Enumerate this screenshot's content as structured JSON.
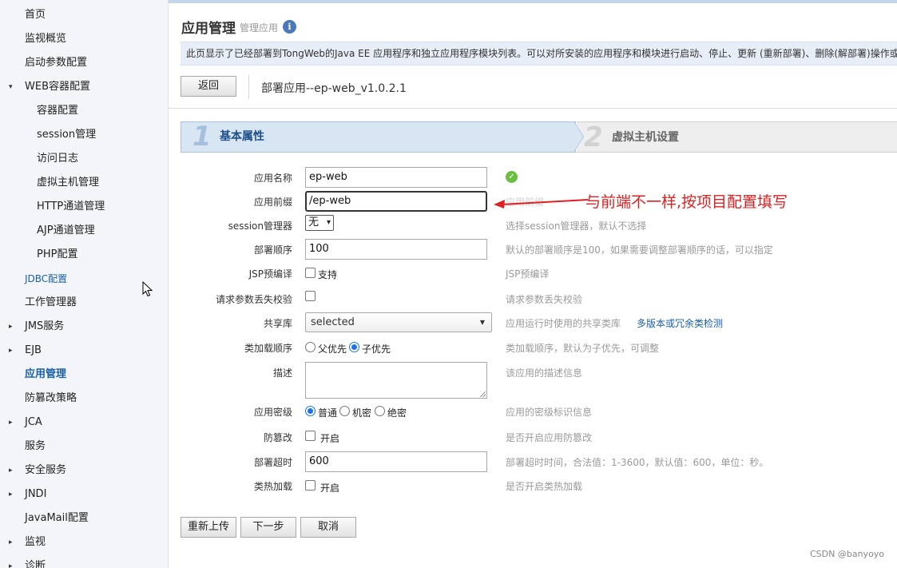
{
  "sidebar": {
    "items": [
      {
        "label": "首页"
      },
      {
        "label": "监视概览"
      },
      {
        "label": "启动参数配置"
      },
      {
        "label": "WEB容器配置",
        "caret": "▾"
      },
      {
        "label": "容器配置"
      },
      {
        "label": "session管理"
      },
      {
        "label": "访问日志"
      },
      {
        "label": "虚拟主机管理"
      },
      {
        "label": "HTTP通道管理"
      },
      {
        "label": "AJP通道管理"
      },
      {
        "label": "PHP配置"
      },
      {
        "label": "JDBC配置"
      },
      {
        "label": "工作管理器"
      },
      {
        "label": "JMS服务",
        "caret": "▸"
      },
      {
        "label": "EJB",
        "caret": "▸"
      },
      {
        "label": "应用管理"
      },
      {
        "label": "防篡改策略"
      },
      {
        "label": "JCA",
        "caret": "▸"
      },
      {
        "label": "服务"
      },
      {
        "label": "安全服务",
        "caret": "▸"
      },
      {
        "label": "JNDI",
        "caret": "▸"
      },
      {
        "label": "JavaMail配置"
      },
      {
        "label": "监视",
        "caret": "▸"
      },
      {
        "label": "诊断",
        "caret": "▸"
      }
    ]
  },
  "header": {
    "title": "应用管理",
    "subtitle": "管理应用",
    "info_glyph": "i",
    "description": "此页显示了已经部署到TongWeb的Java EE 应用程序和独立应用程序模块列表。可以对所安装的应用程序和模块进行启动、停止、更新 (重新部署)、删除(解部署)操作或者"
  },
  "toolbar": {
    "back_label": "返回",
    "deploy_title": "部署应用--ep-web_v1.0.2.1"
  },
  "steps": [
    {
      "num": "1",
      "label": "基本属性"
    },
    {
      "num": "2",
      "label": "虚拟主机设置"
    }
  ],
  "form": {
    "app_name": {
      "label": "应用名称",
      "value": "ep-web"
    },
    "app_prefix": {
      "label": "应用前缀",
      "value": "/ep-web",
      "hint": "应用前缀"
    },
    "session_mgr": {
      "label": "session管理器",
      "value": "无",
      "hint": "选择session管理器，默认不选择"
    },
    "deploy_order": {
      "label": "部署顺序",
      "value": "100",
      "hint": "默认的部署顺序是100，如果需要调整部署顺序的话，可以指定"
    },
    "jsp_precompile": {
      "label": "JSP预编译",
      "option": "支持",
      "hint": "JSP预编译"
    },
    "param_check": {
      "label": "请求参数丢失校验",
      "hint": "请求参数丢失校验"
    },
    "shared_lib": {
      "label": "共享库",
      "value": "selected",
      "hint": "应用运行时使用的共享类库",
      "link": "多版本或冗余类检测"
    },
    "class_order": {
      "label": "类加载顺序",
      "opt1": "父优先",
      "opt2": "子优先",
      "hint": "类加载顺序，默认为子优先，可调整"
    },
    "description": {
      "label": "描述",
      "hint": "该应用的描述信息"
    },
    "secret_level": {
      "label": "应用密级",
      "opt1": "普通",
      "opt2": "机密",
      "opt3": "绝密",
      "hint": "应用的密级标识信息"
    },
    "tamper": {
      "label": "防篡改",
      "option": "开启",
      "hint": "是否开启应用防篡改"
    },
    "deploy_timeout": {
      "label": "部署超时",
      "value": "600",
      "hint": "部署超时时间，合法值：1-3600，默认值：600，单位：秒。"
    },
    "hot_reload": {
      "label": "类热加载",
      "option": "开启",
      "hint": "是否开启类热加载"
    }
  },
  "actions": {
    "reupload": "重新上传",
    "next": "下一步",
    "cancel": "取消"
  },
  "annotation": "与前端不一样,按项目配置填写",
  "watermark": "CSDN @banyoyo",
  "colors": {
    "accent": "#1a5fa8",
    "annotation": "#e02020",
    "step_active_bg": "#d8e5f3",
    "ok_green": "#6bbf3e"
  }
}
